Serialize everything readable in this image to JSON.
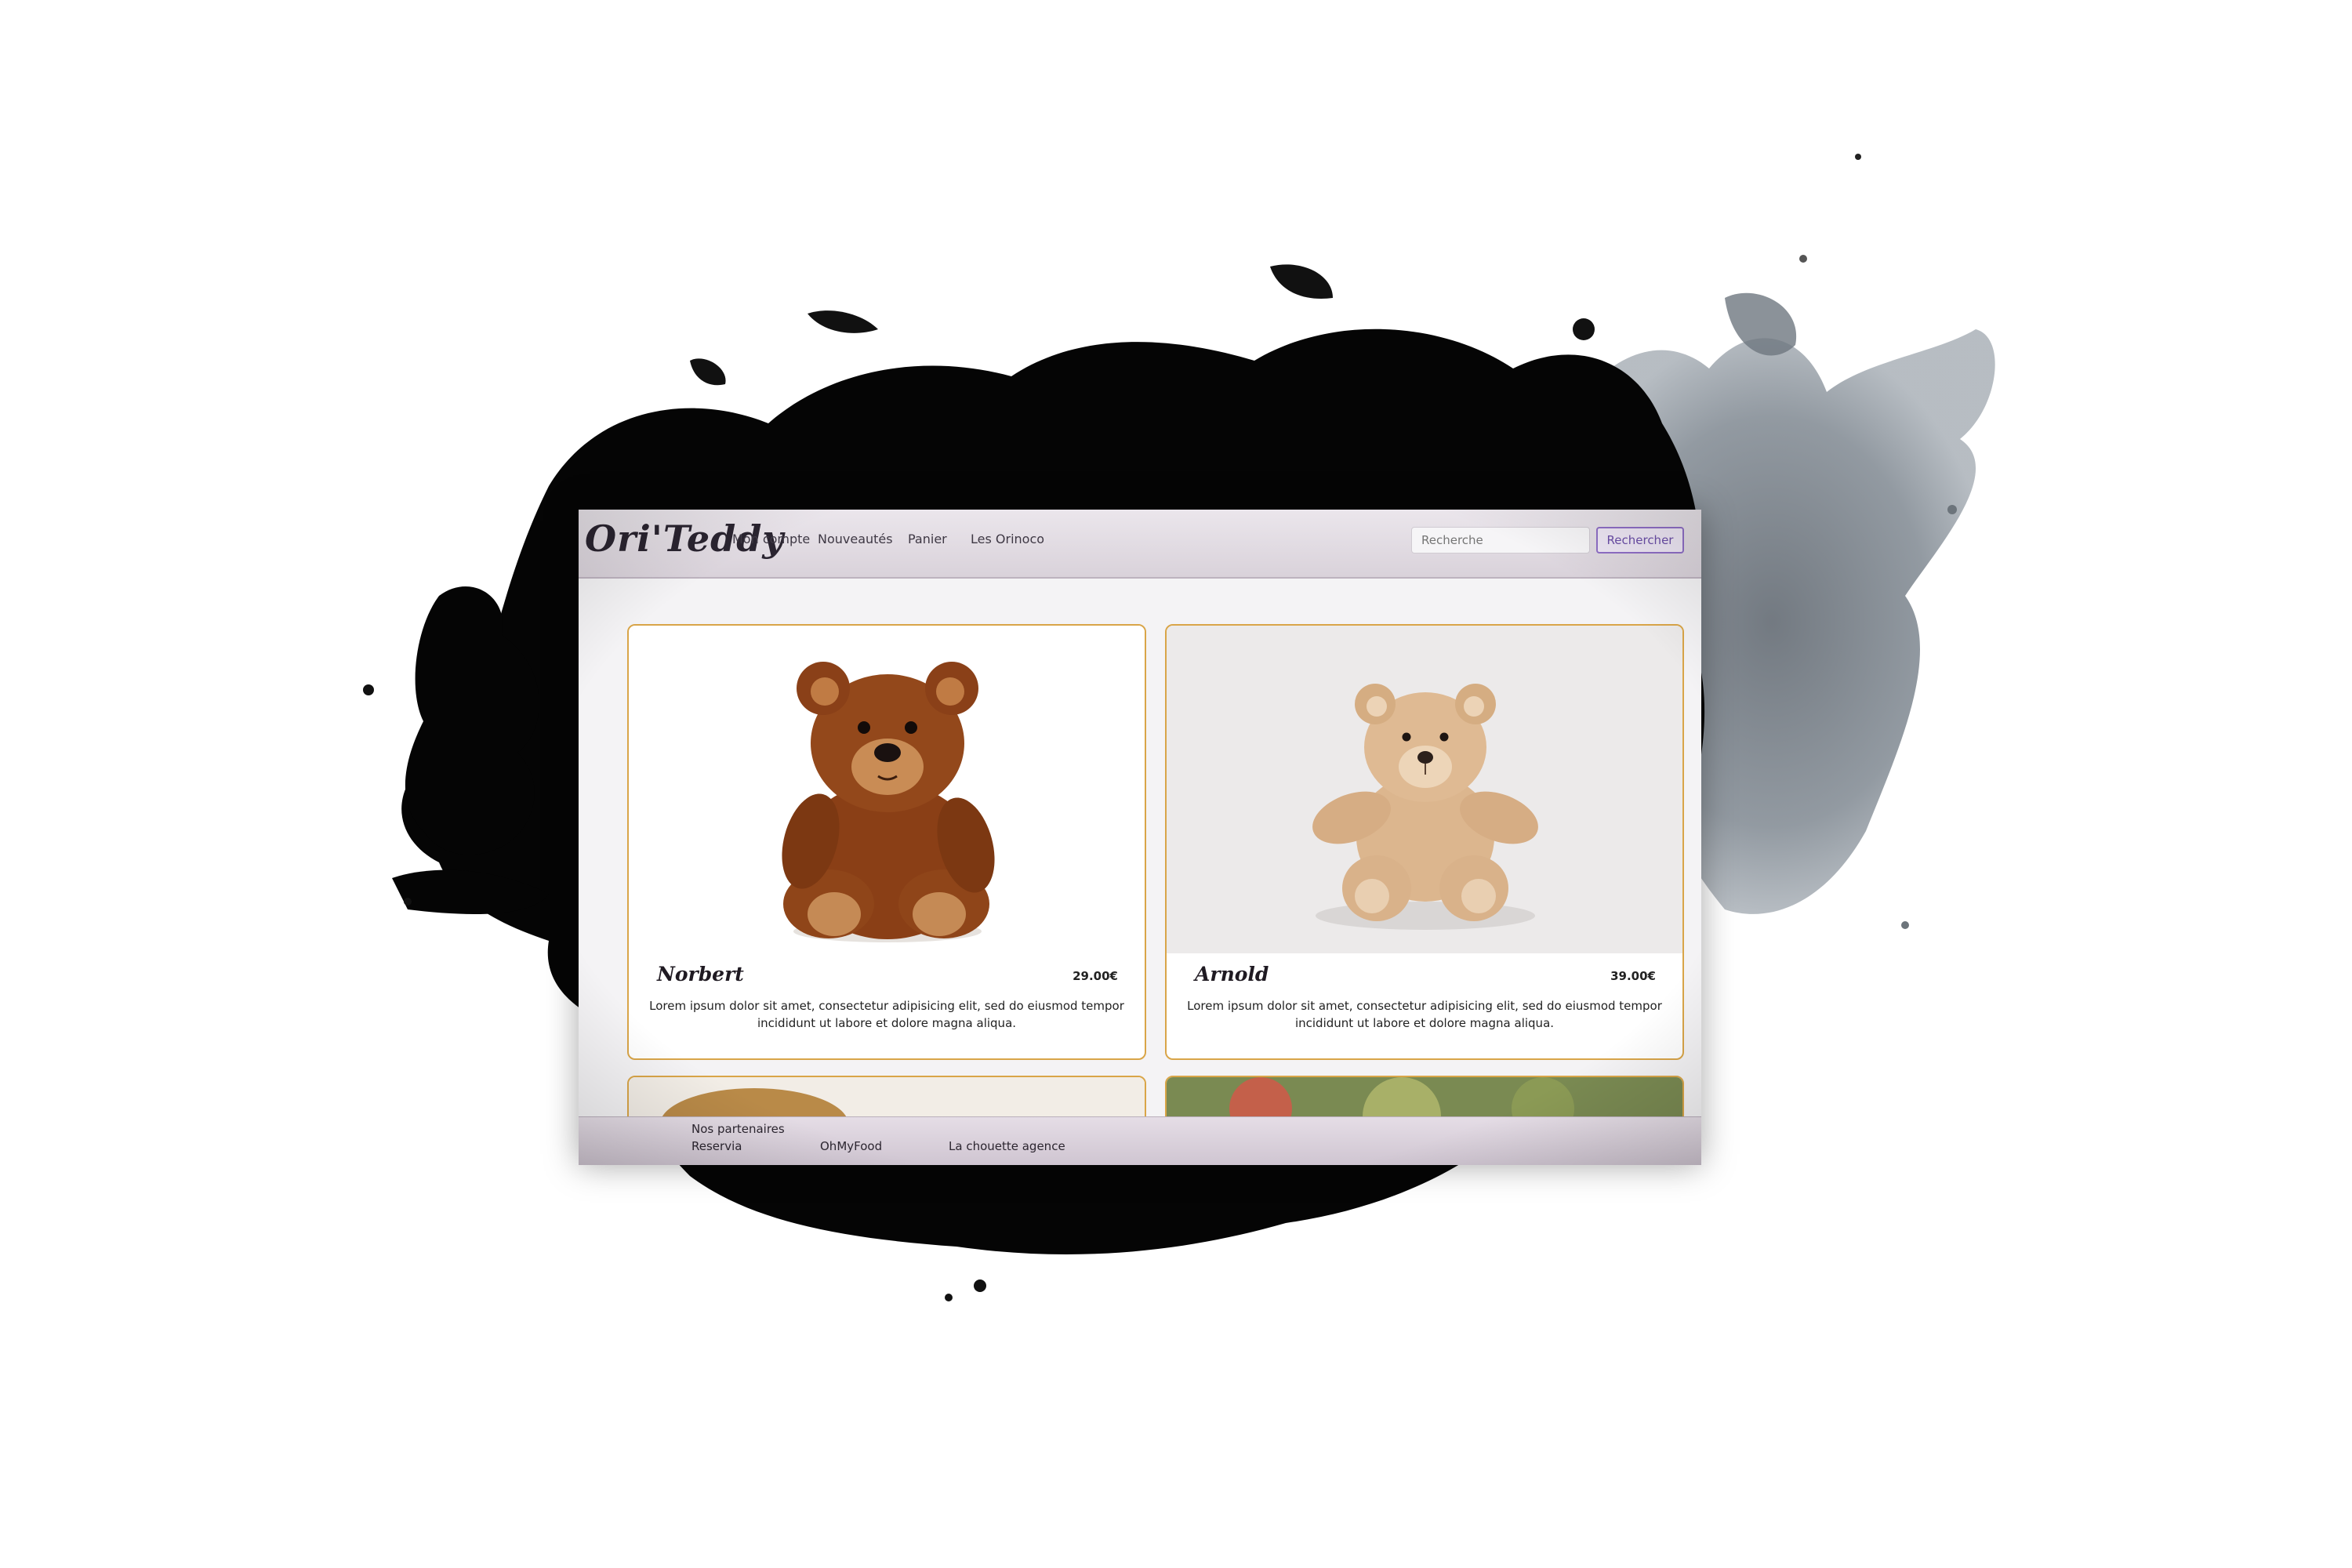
{
  "navbar": {
    "brand": "Ori'Teddy",
    "links": [
      "Mon compte",
      "Nouveautés",
      "Panier",
      "Les Orinoco"
    ],
    "search_placeholder": "Recherche",
    "search_button": "Rechercher"
  },
  "products": [
    {
      "name": "Norbert",
      "price": "29.00€",
      "description": "Lorem ipsum dolor sit amet, consectetur adipisicing elit, sed do eiusmod tempor incididunt ut labore et dolore magna aliqua."
    },
    {
      "name": "Arnold",
      "price": "39.00€",
      "description": "Lorem ipsum dolor sit amet, consectetur adipisicing elit, sed do eiusmod tempor incididunt ut labore et dolore magna aliqua."
    }
  ],
  "footer": {
    "title": "Nos partenaires",
    "partners": [
      "Reservia",
      "OhMyFood",
      "La chouette agence"
    ]
  },
  "colors": {
    "card_border": "#d9a548",
    "search_button": "#8f6fc6",
    "navbar": "#e3dde4"
  }
}
